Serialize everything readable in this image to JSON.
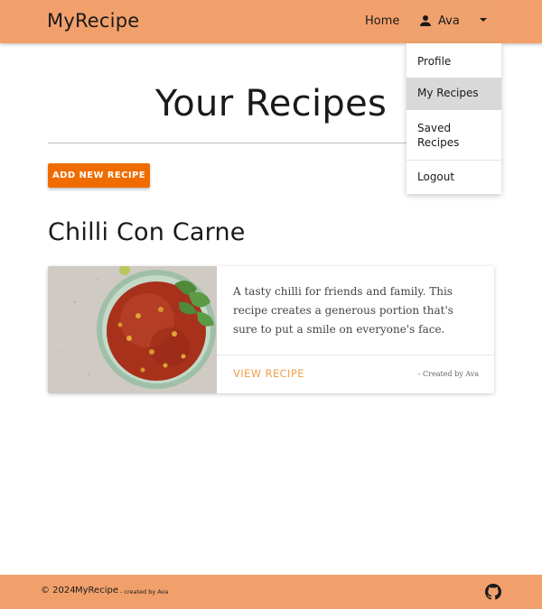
{
  "app": {
    "brand": "MyRecipe"
  },
  "nav": {
    "home_label": "Home",
    "user_name": "Ava",
    "user_icon": "person-icon",
    "caret_icon": "caret-down-icon"
  },
  "dropdown": {
    "items": [
      {
        "label": "Profile",
        "active": false
      },
      {
        "label": "My Recipes",
        "active": true
      },
      {
        "label": "Saved\nRecipes",
        "active": false
      },
      {
        "label": "Logout",
        "active": false
      }
    ]
  },
  "main": {
    "title": "Your Recipes",
    "add_button_label": "ADD NEW RECIPE"
  },
  "recipes": [
    {
      "heading": "Chilli Con Carne",
      "image_alt": "bowl-of-chilli",
      "description": "A tasty chilli for friends and family. This recipe creates a generous portion that's sure to put a smile on everyone's face.",
      "link_label": "VIEW RECIPE",
      "created_by": "- Created by Ava"
    }
  ],
  "footer": {
    "copyright": "© 2024",
    "brand": "MyRecipe",
    "created_by": "- created by Ava",
    "github_icon": "github-icon"
  },
  "colors": {
    "primary": "#f2a06b",
    "accent_button": "#ef6c00",
    "link": "#f0a04b",
    "active_menu": "#d9d9d9"
  }
}
